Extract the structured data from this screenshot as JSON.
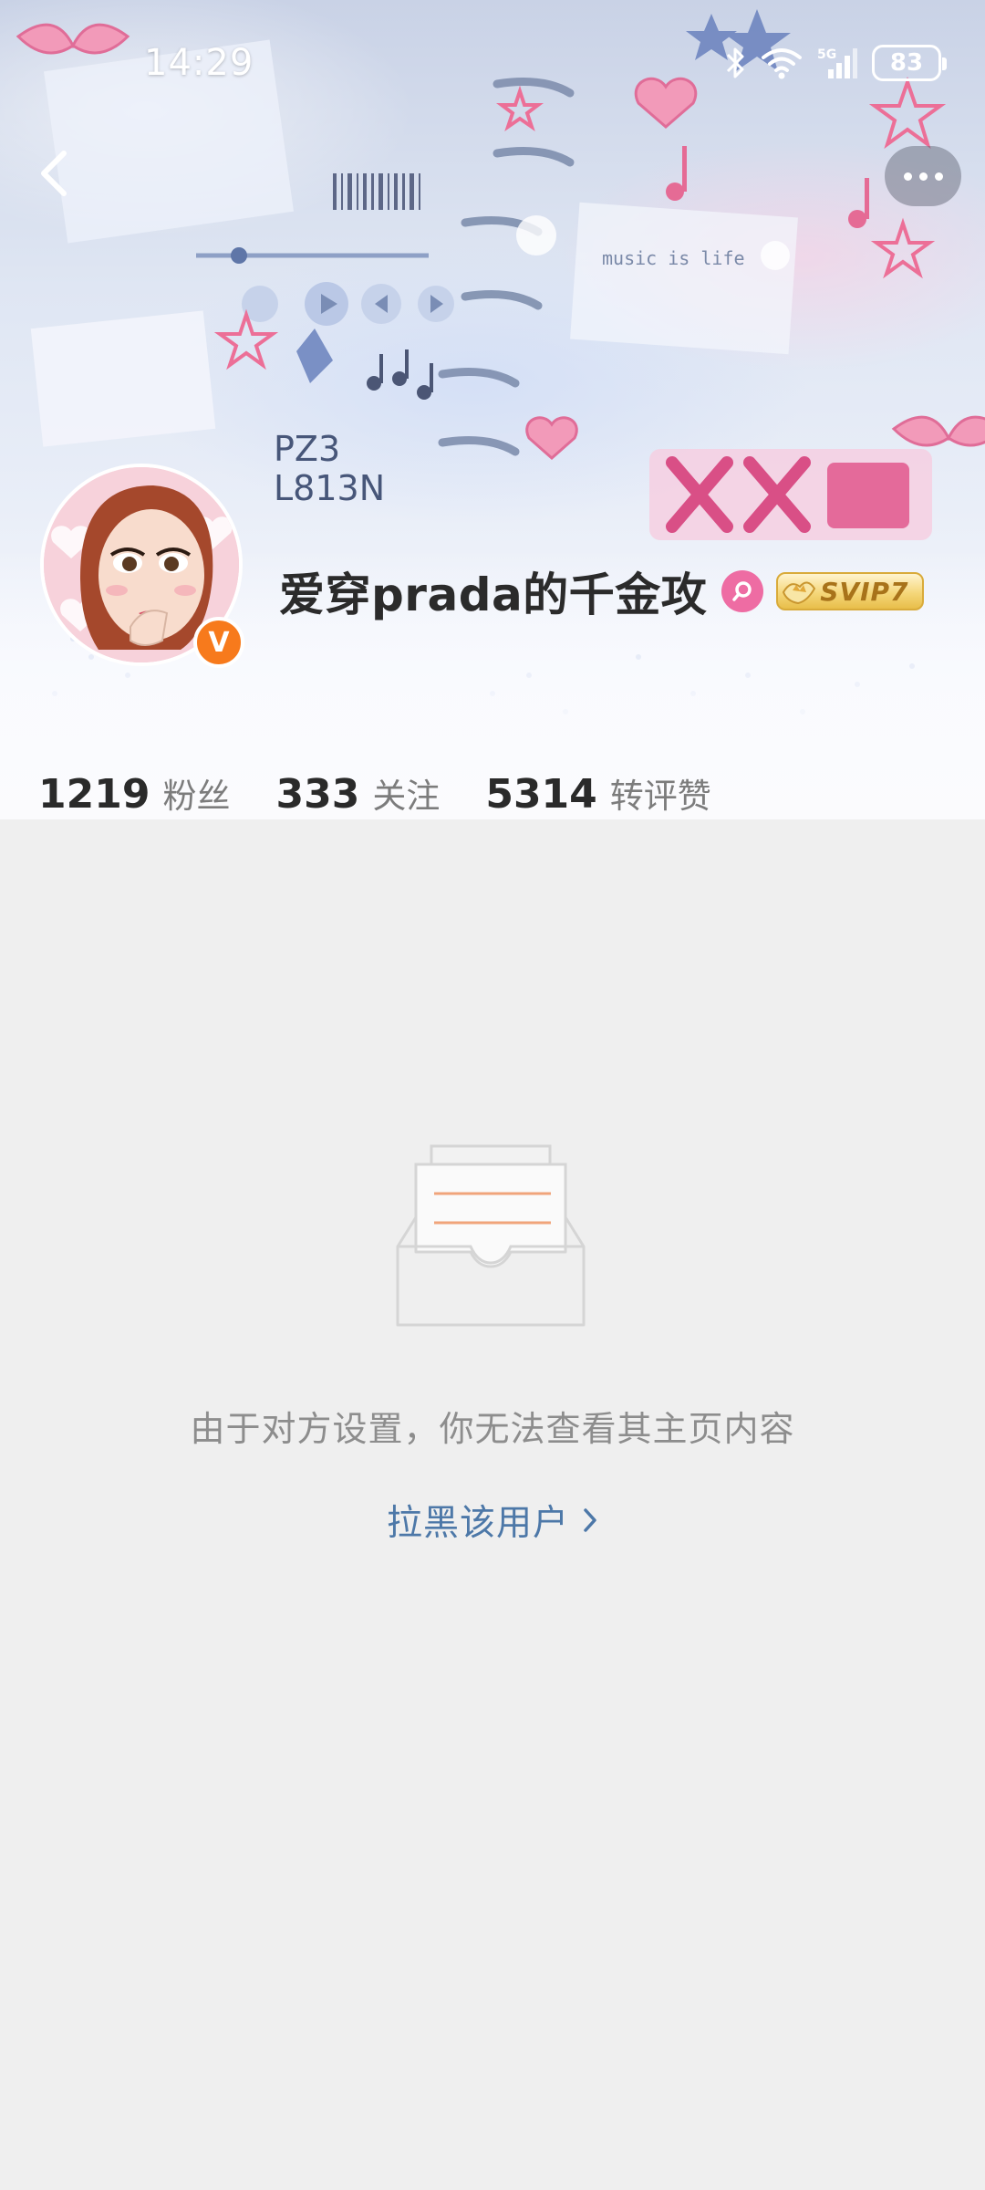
{
  "status_bar": {
    "time": "14:29",
    "network": "5G",
    "battery": "83"
  },
  "header": {
    "back_icon": "chevron-left-icon",
    "more_icon": "more-dots-icon"
  },
  "banner": {
    "caption_text_1": "music is life",
    "caption_text_2": "PZ3",
    "caption_text_3": "L813N"
  },
  "profile": {
    "name": "爱穿prada的千金攻",
    "verify_letter": "V",
    "vip_label": "SVIP7"
  },
  "stats": [
    {
      "value": "1219",
      "label": "粉丝"
    },
    {
      "value": "333",
      "label": "关注"
    },
    {
      "value": "5314",
      "label": "转评赞"
    }
  ],
  "empty_state": {
    "message": "由于对方设置，你无法查看其主页内容",
    "action_label": "拉黑该用户"
  },
  "colors": {
    "accent_link": "#4d78a8",
    "verify_orange": "#f77a1c",
    "background": "#efefef"
  }
}
